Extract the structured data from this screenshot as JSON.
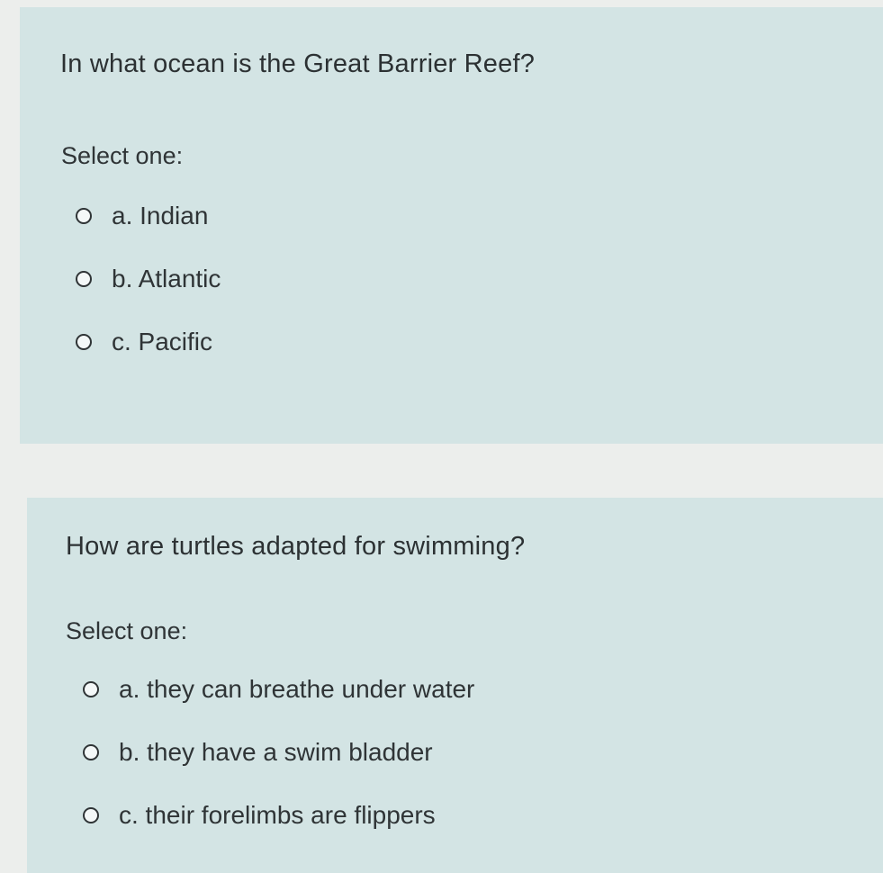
{
  "quiz": {
    "questions": [
      {
        "text": "In what ocean is the Great Barrier Reef?",
        "prompt": "Select one:",
        "options": [
          {
            "label": "a. Indian",
            "selected": false
          },
          {
            "label": "b. Atlantic",
            "selected": false
          },
          {
            "label": "c. Pacific",
            "selected": false
          }
        ]
      },
      {
        "text": "How are turtles adapted for swimming?",
        "prompt": "Select one:",
        "options": [
          {
            "label": "a. they can breathe under water",
            "selected": false
          },
          {
            "label": "b. they have a swim bladder",
            "selected": false
          },
          {
            "label": "c. their forelimbs are flippers",
            "selected": false
          }
        ]
      }
    ]
  },
  "colors": {
    "question_background": "#d3e4e4",
    "page_background": "#eceeec",
    "text": "#2f3436"
  }
}
